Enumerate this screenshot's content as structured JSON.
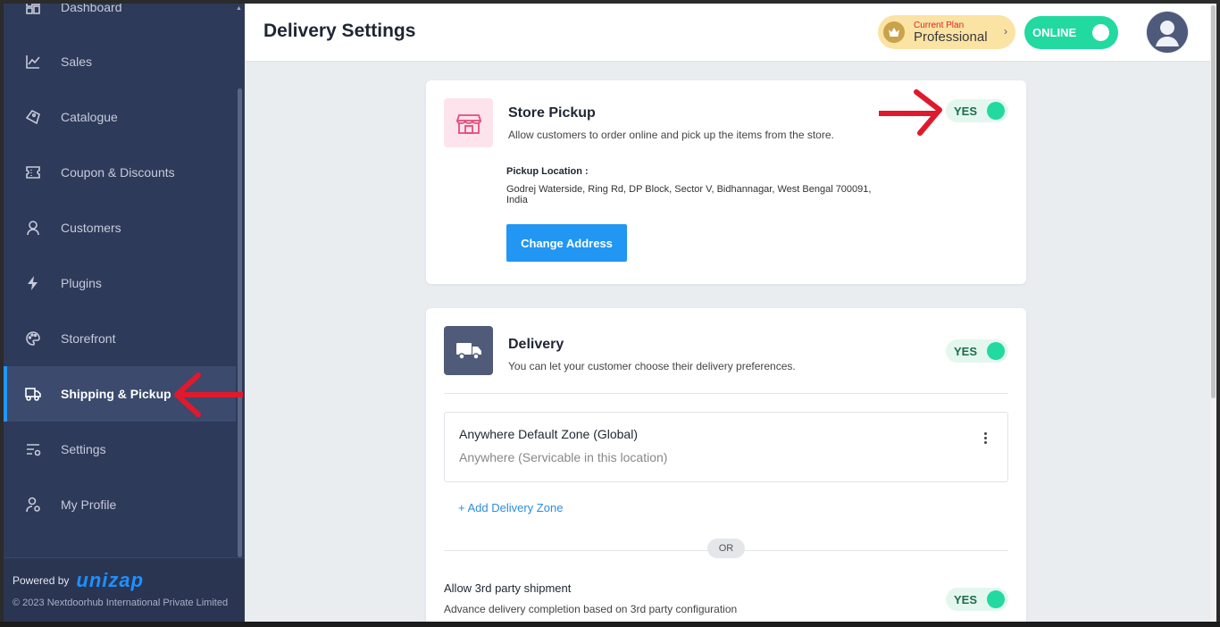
{
  "sidebar": {
    "items": [
      {
        "label": "Dashboard",
        "icon": "dashboard-icon"
      },
      {
        "label": "Sales",
        "icon": "chart-line-icon"
      },
      {
        "label": "Catalogue",
        "icon": "tag-icon"
      },
      {
        "label": "Coupon & Discounts",
        "icon": "coupon-icon"
      },
      {
        "label": "Customers",
        "icon": "user-icon"
      },
      {
        "label": "Plugins",
        "icon": "bolt-icon"
      },
      {
        "label": "Storefront",
        "icon": "palette-icon"
      },
      {
        "label": "Shipping & Pickup",
        "icon": "shipping-icon",
        "active": true
      },
      {
        "label": "Settings",
        "icon": "settings-sliders-icon"
      },
      {
        "label": "My Profile",
        "icon": "profile-gear-icon"
      }
    ],
    "footer": {
      "powered_by": "Powered by",
      "logo_text": "unizap",
      "copyright": "© 2023 Nextdoorhub International Private Limited"
    }
  },
  "header": {
    "title": "Delivery Settings",
    "plan_label": "Current Plan",
    "plan_name": "Professional",
    "status": "ONLINE"
  },
  "store_pickup": {
    "title": "Store Pickup",
    "description": "Allow customers to order online and pick up the items from the store.",
    "toggle": "YES",
    "location_label": "Pickup Location :",
    "address": "Godrej Waterside, Ring Rd, DP Block, Sector V, Bidhannagar, West Bengal 700091, India",
    "change_button": "Change Address"
  },
  "delivery": {
    "title": "Delivery",
    "description": "You can let your customer choose their delivery preferences.",
    "toggle": "YES",
    "zone": {
      "title": "Anywhere Default Zone (Global)",
      "subtitle": "Anywhere (Servicable in this location)"
    },
    "add_zone": "+ Add Delivery Zone",
    "or_label": "OR",
    "third_party": {
      "title": "Allow 3rd party shipment",
      "description": "Advance delivery completion based on 3rd party configuration",
      "toggle": "YES"
    }
  },
  "colors": {
    "sidebar_bg": "#2e3a59",
    "accent": "#2196f3",
    "toggle_green": "#22d9a0",
    "annotation_arrow": "#e0192d"
  }
}
